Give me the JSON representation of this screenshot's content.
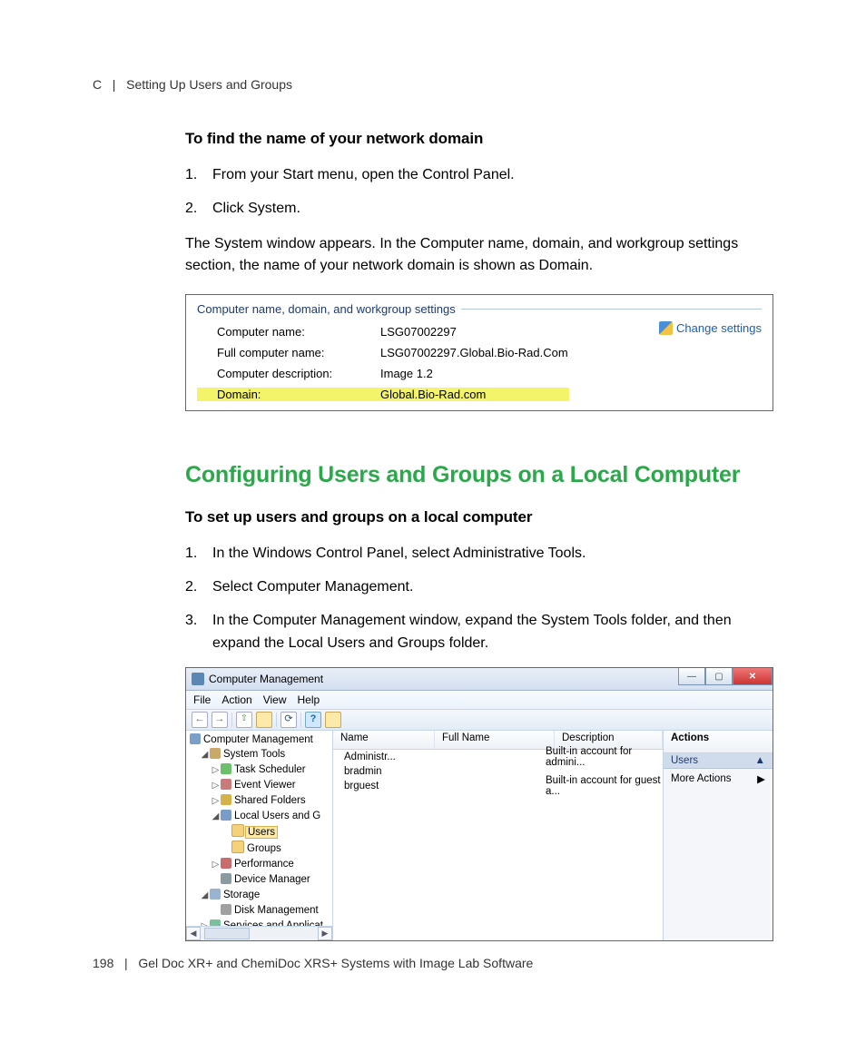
{
  "header": {
    "appendix": "C",
    "section": "Setting Up Users and Groups"
  },
  "sub1_title": "To find the name of your network domain",
  "steps1": {
    "s1": {
      "n": "1.",
      "t": "From your Start menu, open the Control Panel."
    },
    "s2": {
      "n": "2.",
      "t": "Click System."
    }
  },
  "para1": "The System window appears. In the Computer name, domain, and workgroup settings section, the name of your network domain is shown as Domain.",
  "panel": {
    "legend": "Computer name, domain, and workgroup settings",
    "rows": {
      "r1": {
        "label": "Computer name:",
        "value": "LSG07002297"
      },
      "r2": {
        "label": "Full computer name:",
        "value": "LSG07002297.Global.Bio-Rad.Com"
      },
      "r3": {
        "label": "Computer description:",
        "value": "Image 1.2"
      },
      "r4": {
        "label": "Domain:",
        "value": "Global.Bio-Rad.com"
      }
    },
    "change_link": "Change settings"
  },
  "section2_heading": "Configuring Users and Groups on a Local Computer",
  "sub2_title": "To set up users and groups on a local computer",
  "steps2": {
    "s1": {
      "n": "1.",
      "t": "In the Windows Control Panel, select Administrative Tools."
    },
    "s2": {
      "n": "2.",
      "t": "Select Computer Management."
    },
    "s3": {
      "n": "3.",
      "t": "In the Computer Management window, expand the System Tools folder, and then expand the Local Users and Groups folder."
    }
  },
  "cm": {
    "title": "Computer Management",
    "menus": {
      "m1": "File",
      "m2": "Action",
      "m3": "View",
      "m4": "Help"
    },
    "tree": {
      "n0": "Computer Management",
      "n1": "System Tools",
      "n1a": "Task Scheduler",
      "n1b": "Event Viewer",
      "n1c": "Shared Folders",
      "n1d": "Local Users and G",
      "n1d1": "Users",
      "n1d2": "Groups",
      "n1e": "Performance",
      "n1f": "Device Manager",
      "n2": "Storage",
      "n2a": "Disk Management",
      "n3": "Services and Applicat"
    },
    "list": {
      "cols": {
        "c1": "Name",
        "c2": "Full Name",
        "c3": "Description"
      },
      "rows": {
        "r1": {
          "name": "Administr...",
          "full": "",
          "desc": "Built-in account for admini..."
        },
        "r2": {
          "name": "bradmin",
          "full": "",
          "desc": ""
        },
        "r3": {
          "name": "brguest",
          "full": "",
          "desc": "Built-in account for guest a..."
        }
      }
    },
    "actions": {
      "head": "Actions",
      "sub": "Users",
      "arrow": "▲",
      "item": "More Actions",
      "itemarrow": "▶"
    }
  },
  "footer": {
    "page": "198",
    "title": "Gel Doc XR+ and ChemiDoc XRS+ Systems with Image Lab Software"
  }
}
